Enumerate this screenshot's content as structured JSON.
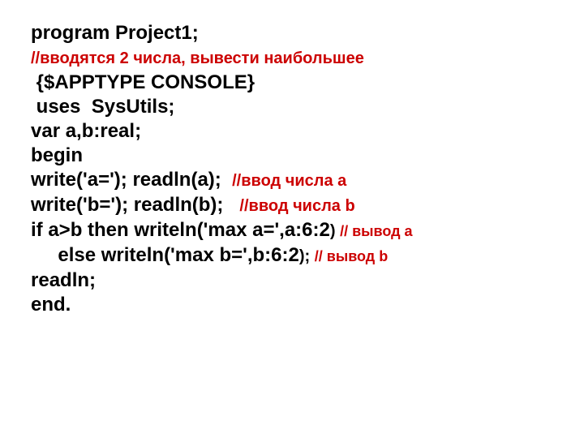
{
  "lines": {
    "l1": "program Project1;",
    "l2": "//вводятся 2 числа, вывести наибольшее",
    "l3": " {$APPTYPE CONSOLE}",
    "l4": " uses  SysUtils;",
    "l5": "var a,b:real;",
    "l6": "begin",
    "l7a": "write('a='); readln(a);  ",
    "l7b": "//ввод числа а",
    "l8a": "write('b='); readln(b);   ",
    "l8b": "//ввод числа b",
    "l9a": "if a>b then writeln('max a=',a:6:2",
    "l9b": ") ",
    "l9c": "// вывод a",
    "l10a": "     else writeln('max b=',b:6:2",
    "l10b": "); ",
    "l10c": "// вывод b",
    "l11": "readln;",
    "l12": "end."
  }
}
